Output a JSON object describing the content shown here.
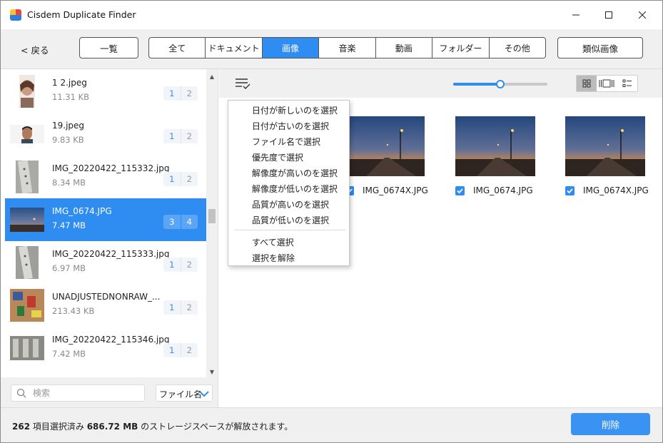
{
  "window": {
    "title": "Cisdem Duplicate Finder",
    "controls": [
      "minimize-icon",
      "maximize-icon",
      "close-icon"
    ]
  },
  "toolbar": {
    "back_label": "< 戻る",
    "list_label": "一覧",
    "similar_label": "類似画像",
    "categories": [
      {
        "label": "全て",
        "active": false
      },
      {
        "label": "ドキュメント",
        "active": false
      },
      {
        "label": "画像",
        "active": true
      },
      {
        "label": "音楽",
        "active": false
      },
      {
        "label": "動画",
        "active": false
      },
      {
        "label": "フォルダー",
        "active": false
      },
      {
        "label": "その他",
        "active": false
      }
    ]
  },
  "file_list": {
    "items": [
      {
        "name": "1 2.jpeg",
        "size": "11.31 KB",
        "badge1": "1",
        "badge2": "2",
        "selected": false,
        "thumb": "portrait-woman"
      },
      {
        "name": "19.jpeg",
        "size": "9.83 KB",
        "badge1": "1",
        "badge2": "2",
        "selected": false,
        "thumb": "portrait-man"
      },
      {
        "name": "IMG_20220422_115332.jpg",
        "size": "8.34 MB",
        "badge1": "1",
        "badge2": "2",
        "selected": false,
        "thumb": "gray-panel"
      },
      {
        "name": "IMG_0674.JPG",
        "size": "7.47 MB",
        "badge1": "3",
        "badge2": "4",
        "selected": true,
        "thumb": "sunset-road"
      },
      {
        "name": "IMG_20220422_115333.jpg",
        "size": "6.97 MB",
        "badge1": "1",
        "badge2": "2",
        "selected": false,
        "thumb": "gray-panel"
      },
      {
        "name": "UNADJUSTEDNONRAW_...",
        "size": "213.43 KB",
        "badge1": "1",
        "badge2": "2",
        "selected": false,
        "thumb": "toy-desk"
      },
      {
        "name": "IMG_20220422_115346.jpg",
        "size": "7.42 MB",
        "badge1": "1",
        "badge2": "2",
        "selected": false,
        "thumb": "workbench"
      }
    ]
  },
  "search": {
    "placeholder": "検索",
    "value": ""
  },
  "sort": {
    "selected": "ファイル名"
  },
  "view": {
    "zoom_fraction": 0.5,
    "modes": [
      {
        "icon": "grid-view-icon",
        "active": true
      },
      {
        "icon": "filmstrip-view-icon",
        "active": false
      },
      {
        "icon": "list-view-icon",
        "active": false
      }
    ]
  },
  "preview": {
    "tiles": [
      {
        "name": "IMG_0674X.JPG",
        "checked": true
      },
      {
        "name": "IMG_0674.JPG",
        "checked": true
      },
      {
        "name": "IMG_0674X.JPG",
        "checked": true
      }
    ]
  },
  "context_menu": {
    "items": [
      "日付が新しいのを選択",
      "日付が古いのを選択",
      "ファイル名で選択",
      "優先度で選択",
      "解像度が高いのを選択",
      "解像度が低いのを選択",
      "品質が高いのを選択",
      "品質が低いのを選択"
    ],
    "extra_items": [
      "すべて選択",
      "選択を解除"
    ]
  },
  "status": {
    "count": "262",
    "count_suffix": " 項目選択済み ",
    "size": "686.72 MB",
    "size_suffix": " のストレージスペースが解放されます。"
  },
  "actions": {
    "delete_label": "削除"
  },
  "colors": {
    "accent": "#2f8cf0",
    "toolbar_bg": "#f0f0f0"
  }
}
